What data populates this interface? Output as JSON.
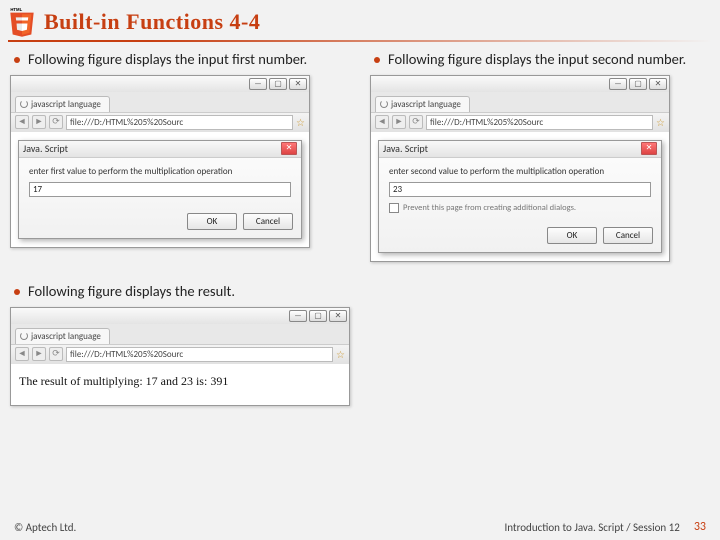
{
  "header": {
    "title": "Built-in Functions 4-4"
  },
  "bullets": {
    "first": "Following figure displays the input first number.",
    "second": "Following figure displays the input second number.",
    "result": "Following figure displays the result."
  },
  "browser": {
    "tab_label": "javascript language",
    "address": "file:///D:/HTML%205%20Sourc",
    "min": "—",
    "max": "▢",
    "close": "✕"
  },
  "dialog": {
    "title": "Java. Script",
    "close": "✕",
    "prompt1": "enter first value to perform the multiplication operation",
    "value1": "17",
    "prompt2": "enter second value to perform the multiplication operation",
    "value2": "23",
    "checkbox_label": "Prevent this page from creating additional dialogs.",
    "ok": "OK",
    "cancel": "Cancel"
  },
  "result_text": "The result of multiplying: 17 and 23 is: 391",
  "footer": {
    "copyright": "© Aptech Ltd.",
    "session": "Introduction to Java. Script / Session 12",
    "page": "33"
  }
}
